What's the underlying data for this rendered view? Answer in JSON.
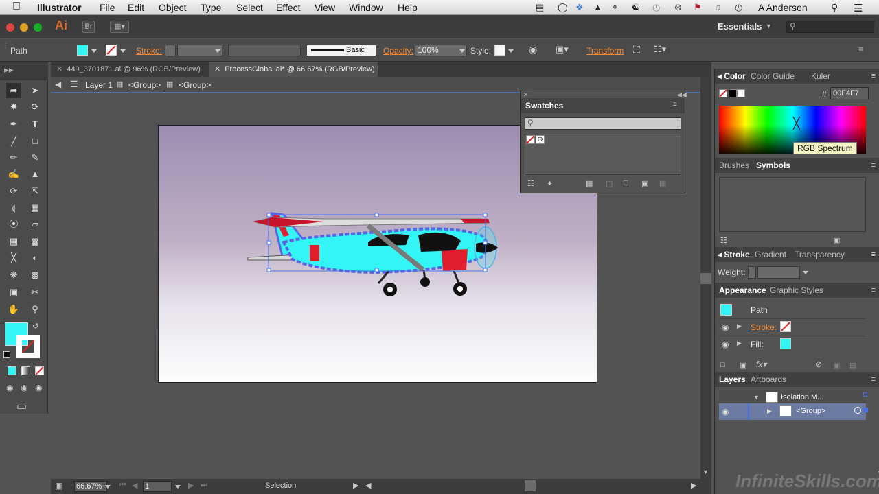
{
  "menubar": {
    "app_name": "Illustrator",
    "menus": [
      "File",
      "Edit",
      "Object",
      "Type",
      "Select",
      "Effect",
      "View",
      "Window",
      "Help"
    ],
    "user": "A Anderson"
  },
  "appbar": {
    "logo": "Ai",
    "bridge_label": "Br",
    "workspace": "Essentials"
  },
  "control": {
    "selection_type": "Path",
    "stroke_label": "Stroke:",
    "brush_label": "Basic",
    "opacity_label": "Opacity:",
    "opacity_value": "100%",
    "style_label": "Style:",
    "transform_label": "Transform",
    "colors": {
      "fill": "#33f5f5",
      "accent": "#f08a3a"
    }
  },
  "tabs": [
    {
      "label": "449_3701871.ai @ 96% (RGB/Preview)",
      "active": false
    },
    {
      "label": "ProcessGlobal.ai* @ 66.67% (RGB/Preview)",
      "active": true
    }
  ],
  "isolation": {
    "layer": "Layer 1",
    "group1": "<Group>",
    "group2": "<Group>"
  },
  "status": {
    "zoom": "66.67%",
    "artboard": "1",
    "tool": "Selection"
  },
  "swatches": {
    "title": "Swatches"
  },
  "color_panel": {
    "tabs": [
      "Color",
      "Color Guide",
      "Kuler"
    ],
    "hex_prefix": "#",
    "hex": "00F4F7",
    "tooltip": "RGB Spectrum"
  },
  "brushes_panel": {
    "tabs": [
      "Brushes",
      "Symbols"
    ]
  },
  "stroke_panel": {
    "tabs": [
      "Stroke",
      "Gradient",
      "Transparency"
    ],
    "weight_label": "Weight:"
  },
  "appearance_panel": {
    "tabs": [
      "Appearance",
      "Graphic Styles"
    ],
    "object": "Path",
    "stroke_label": "Stroke:",
    "fill_label": "Fill:"
  },
  "layers_panel": {
    "tabs": [
      "Layers",
      "Artboards"
    ],
    "layer_name": "Isolation M...",
    "group_name": "<Group>"
  },
  "watermark": "InfiniteSkills.com"
}
